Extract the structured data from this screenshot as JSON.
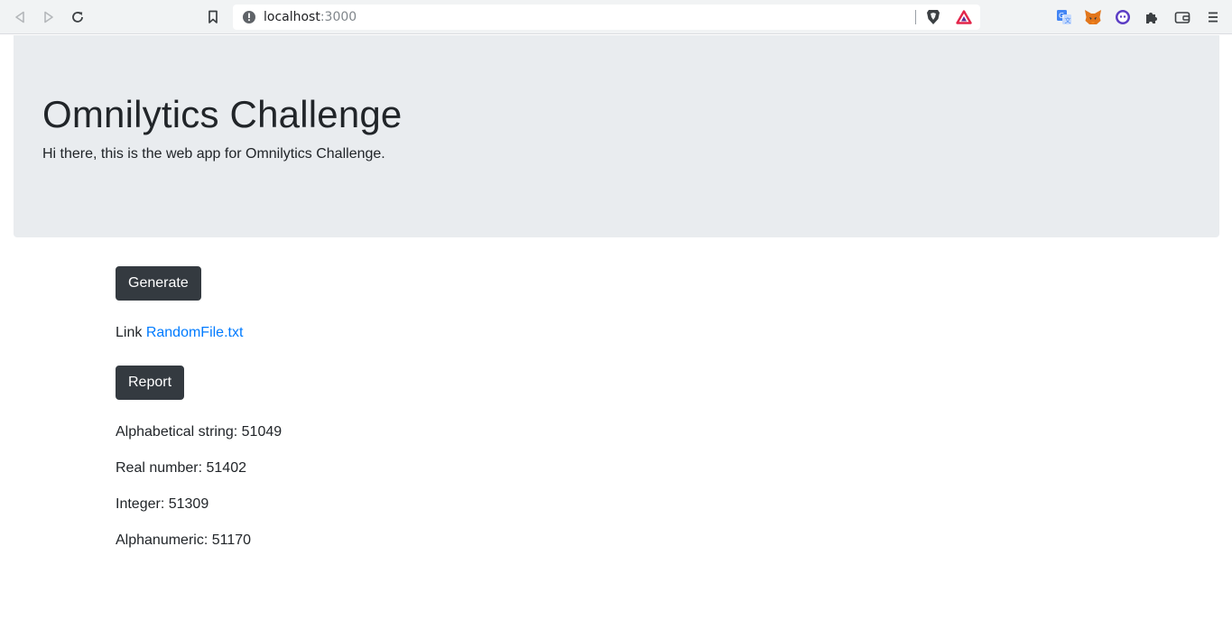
{
  "browser": {
    "url_host": "localhost",
    "url_port": ":3000"
  },
  "jumbotron": {
    "title": "Omnilytics Challenge",
    "lead": "Hi there, this is the web app for Omnilytics Challenge."
  },
  "actions": {
    "generate_label": "Generate",
    "link_prefix": "Link",
    "link_text": "RandomFile.txt",
    "report_label": "Report"
  },
  "report": {
    "alphabetical": {
      "label": "Alphabetical string:",
      "value": "51049"
    },
    "real_number": {
      "label": "Real number:",
      "value": "51402"
    },
    "integer": {
      "label": "Integer:",
      "value": "51309"
    },
    "alphanumeric": {
      "label": "Alphanumeric:",
      "value": "51170"
    }
  },
  "colors": {
    "jumbotron_bg": "#e9ecef",
    "button_dark": "#343a40",
    "link": "#007bff"
  }
}
